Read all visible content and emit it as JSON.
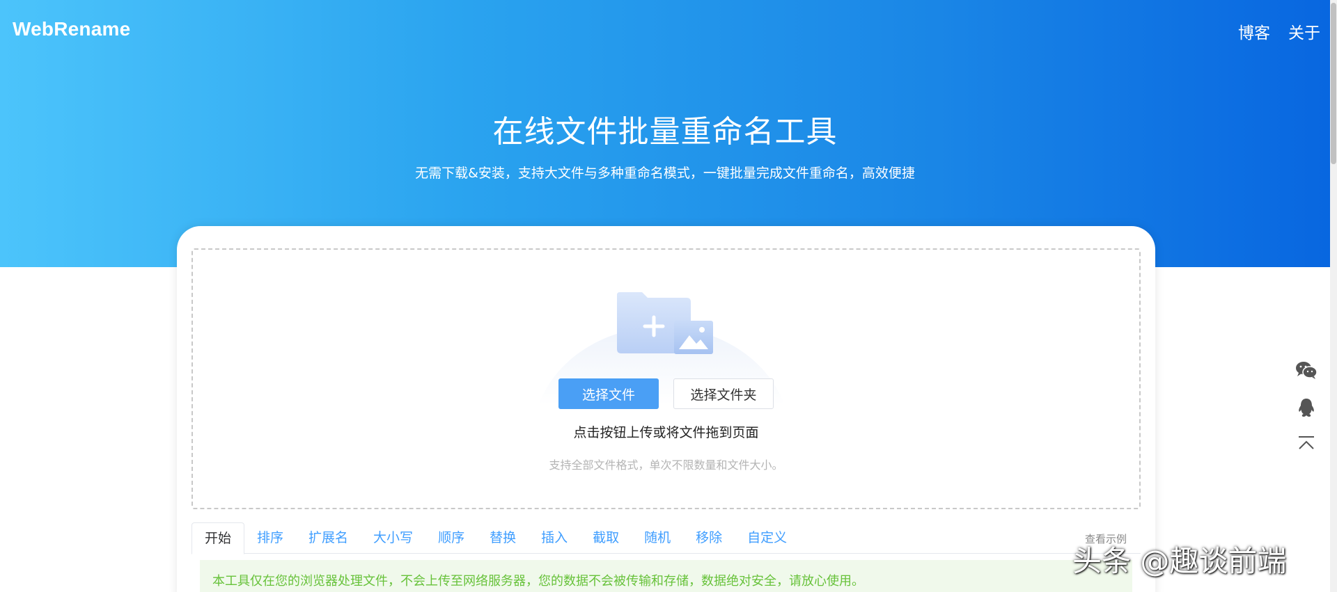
{
  "header": {
    "logo": "WebRename",
    "nav": [
      "博客",
      "关于"
    ]
  },
  "hero": {
    "title": "在线文件批量重命名工具",
    "subtitle": "无需下载&安装，支持大文件与多种重命名模式，一键批量完成文件重命名，高效便捷"
  },
  "upload": {
    "select_files": "选择文件",
    "select_folder": "选择文件夹",
    "hint": "点击按钮上传或将文件拖到页面",
    "note": "支持全部文件格式，单次不限数量和文件大小。"
  },
  "tabs": {
    "items": [
      "开始",
      "排序",
      "扩展名",
      "大小写",
      "顺序",
      "替换",
      "插入",
      "截取",
      "随机",
      "移除",
      "自定义"
    ],
    "active": "开始",
    "example_link": "查看示例"
  },
  "notice": "本工具仅在您的浏览器处理文件，不会上传至网络服务器，您的数据不会被传输和存储，数据绝对安全，请放心使用。",
  "watermark": "头条 @趣谈前端",
  "colors": {
    "gradient_start": "#4cc4fb",
    "gradient_end": "#0866e0",
    "primary": "#4a9ff5",
    "notice_bg": "#f0f9eb",
    "notice_text": "#67c23a"
  },
  "icons": [
    "folder-add-icon",
    "image-icon",
    "wechat-icon",
    "qq-icon",
    "back-to-top-icon"
  ]
}
